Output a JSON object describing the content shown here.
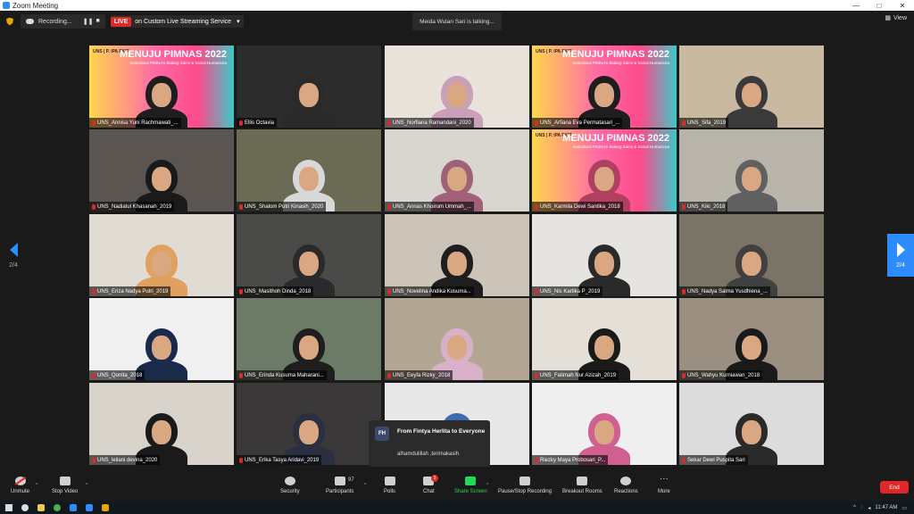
{
  "window": {
    "title": "Zoom Meeting",
    "controls": [
      "—",
      "□",
      "✕"
    ]
  },
  "topbar": {
    "recording_label": "Recording...",
    "live_badge": "LIVE",
    "live_service": "on Custom Live Streaming Service",
    "talking": "Meida Wulan Sari is talking...",
    "view_label": "View"
  },
  "nav": {
    "page_indicator_left": "2/4",
    "page_indicator_right": "2/4"
  },
  "banner": {
    "title": "MENUJU PIMNAS 2022",
    "subtitle": "Sosialisasi PIMNAS Bidang Sains & Sosial Humaniora",
    "logo": "UNS  |  P. IPA FKIP"
  },
  "participants": [
    "UNS_Annisa Yuni Rachmawati_...",
    "Ellis Octavia",
    "UNS_Norfiana Ramandani_2020",
    "UNS_Arfiana Eva Permatasari_...",
    "UNS_Sifa_2019",
    "UNS_Nadiatul Khasanah_2019",
    "UNS_Shalom Putri Kinasih_2020",
    "UNS_Annas Khoirum Ummah_...",
    "UNS_Karmila Dewi Santika_2018",
    "UNS_Kiki_2018",
    "UNS_Eriza Nadya Putri_2019",
    "UNS_Masithoh Dinda_2018",
    "UNS_Novelina Andika Kusuma...",
    "UNS_Nis Kartika P_2019",
    "UNS_Nadya Salma Yusdhiena_...",
    "UNS_Qonita_2018",
    "UNS_Erinda Kusuma Maharani...",
    "UNS_Eeyfa Rizky_2018",
    "UNS_Fatimah Nur Azizah_2019",
    "UNS_Wahyu Kurniawan_2018",
    "UNS_leilani devina_2020",
    "UNS_Erika Tasya Aridavi_2019",
    "",
    "Riezky Maya Probosari_P...",
    "Sekar Dewi Puspita Sari"
  ],
  "chat_popup": {
    "avatar": "FH",
    "from": "From Fintya Herlita to Everyone",
    "message": "alhamdulillah ,terimakasih"
  },
  "toolbar": {
    "unmute": "Unmute",
    "stop_video": "Stop Video",
    "security": "Security",
    "participants": "Participants",
    "participants_count": "97",
    "polls": "Polls",
    "chat": "Chat",
    "chat_badge": "3",
    "share_screen": "Share Screen",
    "pause_recording": "Pause/Stop Recording",
    "breakout": "Breakout Rooms",
    "reactions": "Reactions",
    "more": "More",
    "end": "End"
  },
  "taskbar": {
    "time": "11:47 AM"
  },
  "colors": {
    "accent": "#2d8cff",
    "end_red": "#e02828",
    "share_green": "#23d959"
  }
}
